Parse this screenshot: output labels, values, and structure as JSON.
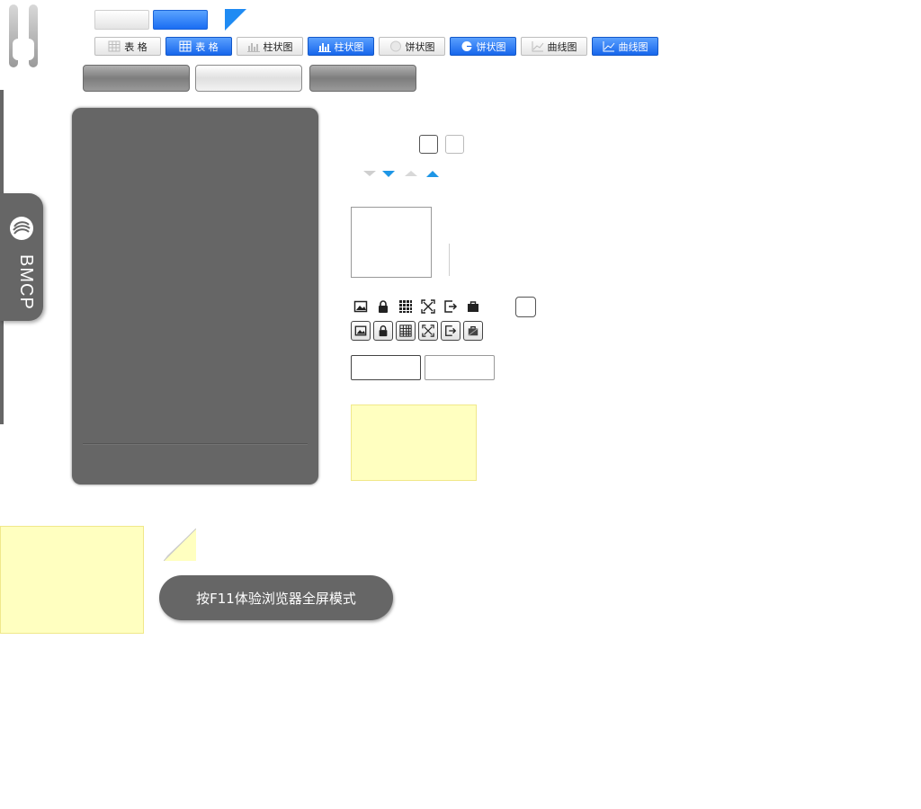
{
  "sidebar": {
    "brand": "BMCP"
  },
  "tabs": [
    {
      "label": "表 格",
      "icon": "table-icon",
      "active": false
    },
    {
      "label": "表 格",
      "icon": "table-icon",
      "active": true
    },
    {
      "label": "柱状图",
      "icon": "bar-chart-icon",
      "active": false
    },
    {
      "label": "柱状图",
      "icon": "bar-chart-icon",
      "active": true
    },
    {
      "label": "饼状图",
      "icon": "pie-chart-icon",
      "active": false
    },
    {
      "label": "饼状图",
      "icon": "pie-chart-icon",
      "active": true
    },
    {
      "label": "曲线图",
      "icon": "line-chart-icon",
      "active": false
    },
    {
      "label": "曲线图",
      "icon": "line-chart-icon",
      "active": true
    }
  ],
  "toolbar_icons": [
    "image-icon",
    "lock-icon",
    "grid-icon",
    "fullscreen-icon",
    "export-icon",
    "briefcase-icon"
  ],
  "fullscreen_hint": "按F11体验浏览器全屏模式",
  "colors": {
    "accent_blue": "#1a6df2",
    "panel_gray": "#666666",
    "note_yellow": "#ffffc0"
  }
}
